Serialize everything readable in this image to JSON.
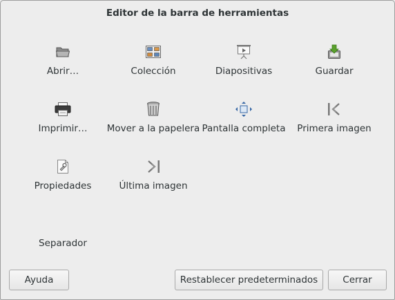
{
  "dialog": {
    "title": "Editor de la barra de herramientas"
  },
  "tools": [
    {
      "label": "Abrir…",
      "icon": "folder-open-icon"
    },
    {
      "label": "Colección",
      "icon": "collection-icon"
    },
    {
      "label": "Diapositivas",
      "icon": "slideshow-icon"
    },
    {
      "label": "Guardar",
      "icon": "save-icon"
    },
    {
      "label": "Imprimir…",
      "icon": "print-icon"
    },
    {
      "label": "Mover a la papelera",
      "icon": "trash-icon"
    },
    {
      "label": "Pantalla completa",
      "icon": "fullscreen-icon"
    },
    {
      "label": "Primera imagen",
      "icon": "first-image-icon"
    },
    {
      "label": "Propiedades",
      "icon": "properties-icon"
    },
    {
      "label": "Última imagen",
      "icon": "last-image-icon"
    },
    {
      "label": "Separador",
      "icon": "separator"
    }
  ],
  "buttons": {
    "help": "Ayuda",
    "reset": "Restablecer predeterminados",
    "close": "Cerrar"
  }
}
